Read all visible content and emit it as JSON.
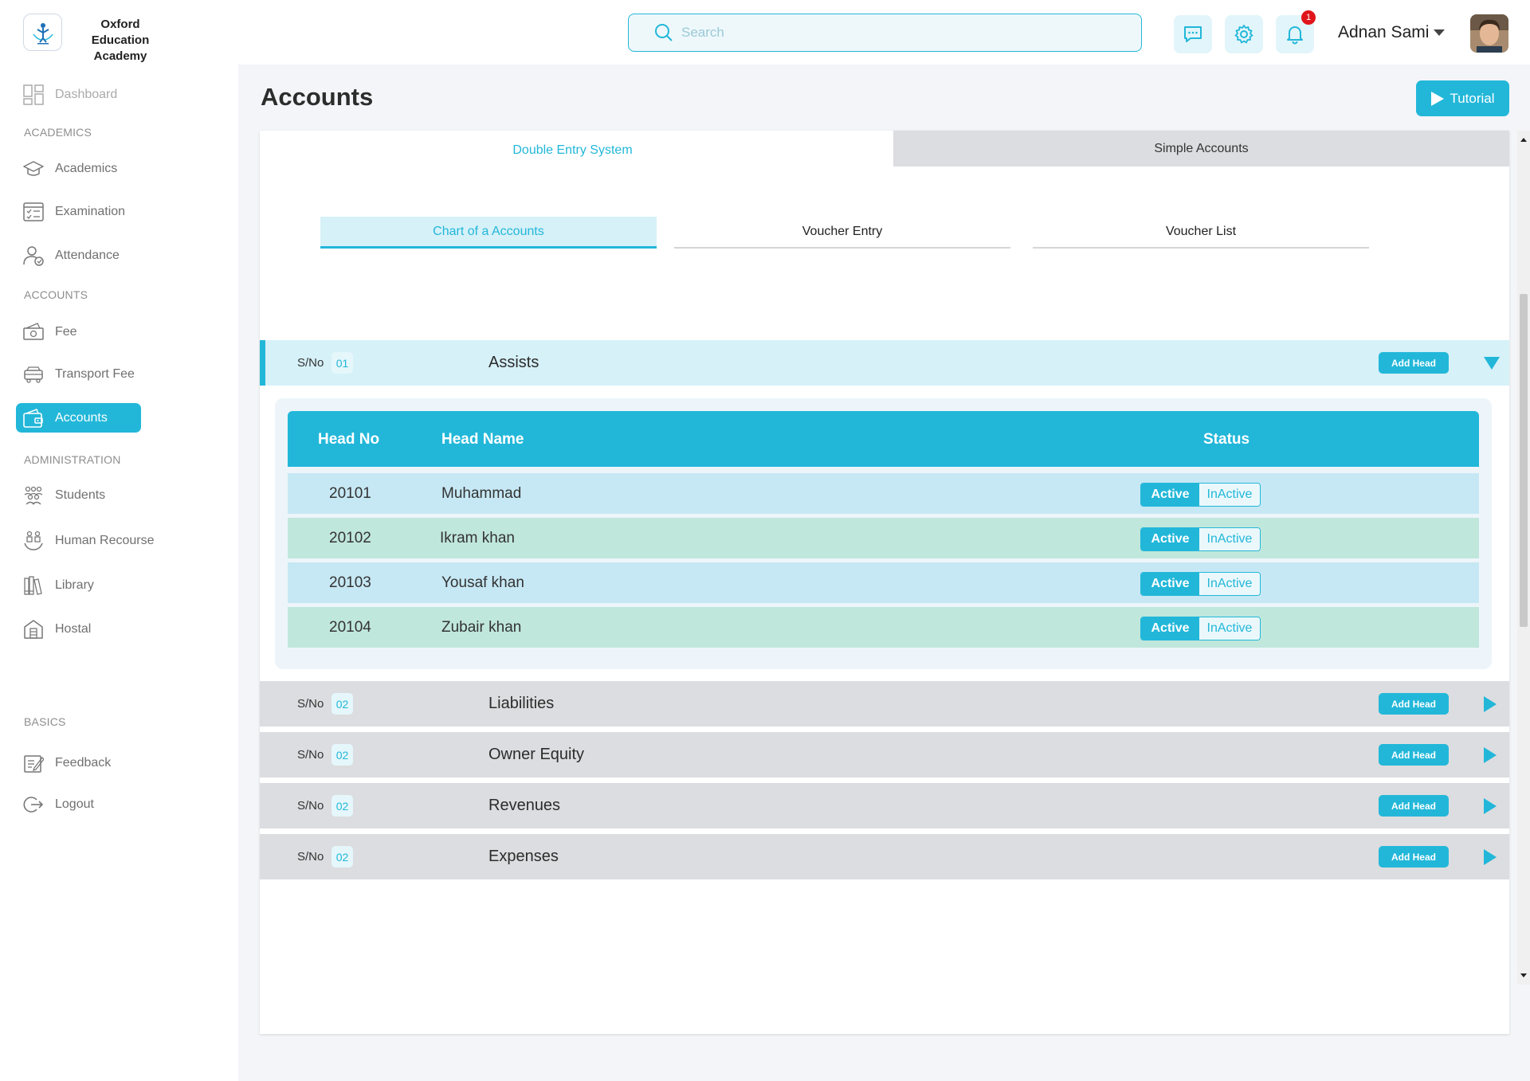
{
  "brand": {
    "name": "Oxford Education Academy"
  },
  "search": {
    "placeholder": "Search"
  },
  "header": {
    "notifications_count": "1",
    "user_name": "Adnan Sami"
  },
  "sidebar": {
    "dashboard": "Dashboard",
    "sections": {
      "academics": "ACADEMICS",
      "accounts": "ACCOUNTS",
      "administration": "ADMINISTRATION",
      "basics": "BASICS"
    },
    "items": {
      "academics": "Academics",
      "examination": "Examination",
      "attendance": "Attendance",
      "fee": "Fee",
      "transport_fee": "Transport Fee",
      "accounts": "Accounts",
      "students": "Students",
      "human_resource": "Human Recourse",
      "library": "Library",
      "hostal": "Hostal",
      "feedback": "Feedback",
      "logout": "Logout"
    }
  },
  "main": {
    "title": "Accounts",
    "tutorial_label": "Tutorial",
    "tabs": {
      "double_entry": "Double Entry System",
      "simple": "Simple Accounts"
    },
    "subtabs": {
      "chart": "Chart of a Accounts",
      "voucher_entry": "Voucher Entry",
      "voucher_list": "Voucher List"
    },
    "sno_label": "S/No",
    "add_head_label": "Add Head",
    "accounts": [
      {
        "sno": "01",
        "name": "Assists"
      },
      {
        "sno": "02",
        "name": "Liabilities"
      },
      {
        "sno": "02",
        "name": "Owner Equity"
      },
      {
        "sno": "02",
        "name": "Revenues"
      },
      {
        "sno": "02",
        "name": "Expenses"
      }
    ],
    "table": {
      "headers": {
        "head_no": "Head No",
        "head_name": "Head Name",
        "status": "Status"
      },
      "status_active": "Active",
      "status_inactive": "InActive",
      "rows": [
        {
          "no": "20101",
          "name": "Muhammad"
        },
        {
          "no": "20102",
          "name": "Ikram khan"
        },
        {
          "no": "20103",
          "name": "Yousaf khan"
        },
        {
          "no": "20104",
          "name": "Zubair khan"
        }
      ]
    }
  },
  "colors": {
    "accent": "#22b7d9",
    "row_blue": "#c6e8f4",
    "row_green": "#c0e7dc",
    "inactive_tab": "#dcdde0"
  }
}
